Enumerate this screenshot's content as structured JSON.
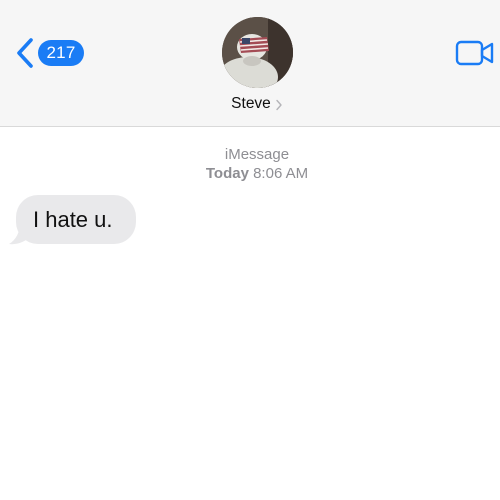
{
  "header": {
    "back_badge_count": "217",
    "contact_name": "Steve",
    "colors": {
      "accent": "#1a7cf5",
      "header_bg": "#f6f6f6"
    },
    "icons": {
      "back": "chevron-left-icon",
      "video": "video-camera-icon",
      "name_disclosure": "chevron-right-icon"
    }
  },
  "conversation": {
    "service_label": "iMessage",
    "timestamp_day": "Today",
    "timestamp_time": "8:06 AM",
    "messages": [
      {
        "direction": "incoming",
        "text": "I hate u."
      }
    ],
    "colors": {
      "incoming_bubble": "#e9e9eb",
      "meta_text": "#8e8e93"
    }
  }
}
